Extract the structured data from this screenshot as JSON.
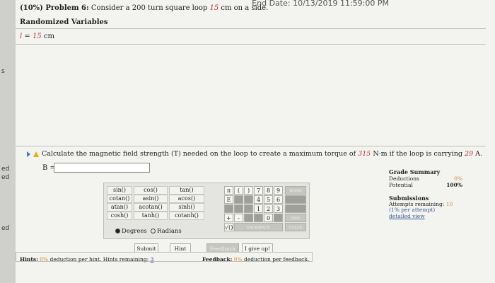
{
  "header": {
    "end_date_label": "End Date: 10/13/2019 11:59:00 PM",
    "problem_prefix": "(10%) Problem 6:",
    "problem_text": " Consider a 200 turn square loop ",
    "problem_value": "15",
    "problem_suffix": " cm on a side."
  },
  "randomized": {
    "title": "Randomized Variables",
    "var_name": "l",
    "var_eq": " = ",
    "var_value": "15",
    "var_unit": " cm"
  },
  "question": {
    "text1": "Calculate the magnetic field strength (T) needed on the loop to create a maximum torque of ",
    "torque": "315",
    "text2": " N·m if the loop is carrying ",
    "current": "29",
    "text3": " A.",
    "answer_label": "B = ",
    "answer_value": ""
  },
  "grade_summary": {
    "title": "Grade Summary",
    "deductions_label": "Deductions",
    "deductions_value": "0%",
    "potential_label": "Potential",
    "potential_value": "100%"
  },
  "submissions": {
    "title": "Submissions",
    "attempts_label": "Attempts remaining:",
    "attempts_value": "10",
    "per_attempt": "(1% per attempt)",
    "detailed_view": "detailed view"
  },
  "calculator": {
    "functions": [
      [
        "sin()",
        "cos()",
        "tan()"
      ],
      [
        "cotan()",
        "asin()",
        "acos()"
      ],
      [
        "atan()",
        "acotan()",
        "sinh()"
      ],
      [
        "cosh()",
        "tanh()",
        "cotanh()"
      ]
    ],
    "pi": "π",
    "e": "E",
    "open_paren": "(",
    "close_paren": ")",
    "digits": [
      [
        "7",
        "8",
        "9"
      ],
      [
        "4",
        "5",
        "6"
      ],
      [
        "1",
        "2",
        "3"
      ],
      [
        "0"
      ]
    ],
    "plus": "+",
    "minus": "-",
    "sqrt": "√()",
    "backspace": "BACKSPACE",
    "home": "HOME",
    "end": "END",
    "clear": "CLEAR",
    "degrees": "Degrees",
    "radians": "Radians",
    "angle_mode": "Degrees"
  },
  "buttons": {
    "submit": "Submit",
    "hint": "Hint",
    "feedback": "Feedback",
    "give_up": "I give up!"
  },
  "footer": {
    "hints_label": "Hints:",
    "hints_pct": "0%",
    "hints_text": " deduction per hint. Hints remaining:",
    "hints_remaining": "3",
    "feedback_label": "Feedback:",
    "feedback_pct": "0%",
    "feedback_text": " deduction per feedback."
  },
  "side_edge": [
    "s",
    "ed",
    "ed",
    "ed"
  ]
}
